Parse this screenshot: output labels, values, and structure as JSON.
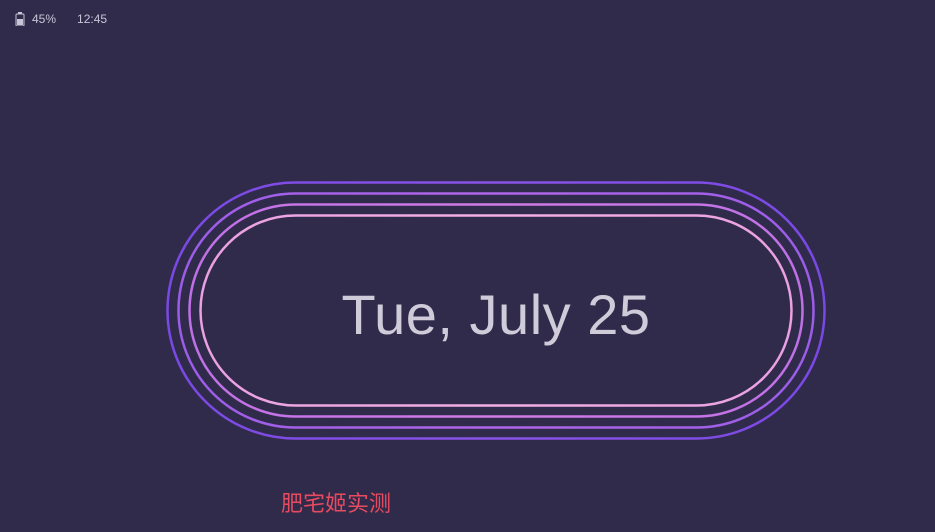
{
  "status_bar": {
    "battery_icon": "battery-icon",
    "battery_level": "45%",
    "time": "12:45"
  },
  "clock_face": {
    "date": "Tue, July 25",
    "ring_colors": [
      "#7c4ae6",
      "#a060ea",
      "#c873e6",
      "#f0a8e0"
    ]
  },
  "watermark": {
    "text": "肥宅姬实测"
  },
  "colors": {
    "background": "#302b4b",
    "text": "#cfcbd9",
    "watermark": "#e84a5f"
  }
}
